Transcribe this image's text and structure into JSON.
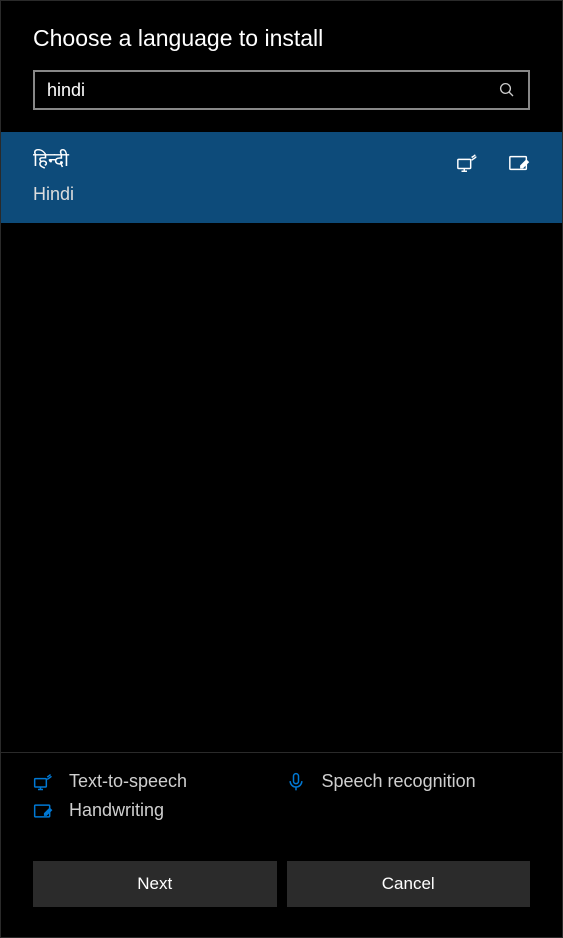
{
  "title": "Choose a language to install",
  "search": {
    "value": "hindi"
  },
  "result": {
    "native": "हिन्दी",
    "english": "Hindi"
  },
  "features": {
    "tts": "Text-to-speech",
    "speech": "Speech recognition",
    "handwriting": "Handwriting"
  },
  "buttons": {
    "next": "Next",
    "cancel": "Cancel"
  },
  "colors": {
    "accent": "#0078d4",
    "selection": "#0d4b7a"
  }
}
